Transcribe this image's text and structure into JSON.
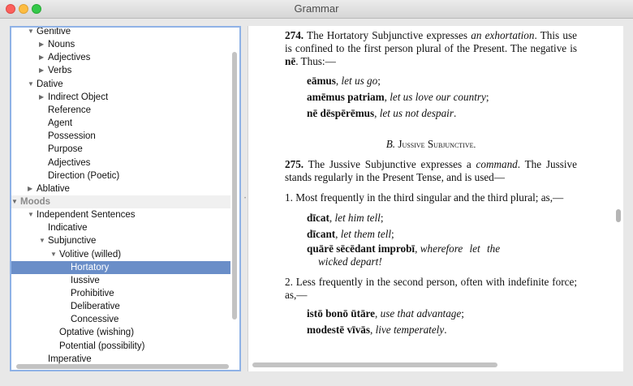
{
  "window": {
    "title": "Grammar"
  },
  "sidebar": {
    "rows": [
      {
        "label": "Genitive",
        "indent": 0,
        "tri": "▼"
      },
      {
        "label": "Nouns",
        "indent": 1,
        "tri": "▶"
      },
      {
        "label": "Adjectives",
        "indent": 1,
        "tri": "▶"
      },
      {
        "label": "Verbs",
        "indent": 1,
        "tri": "▶"
      },
      {
        "label": "Dative",
        "indent": 0,
        "tri": "▼"
      },
      {
        "label": "Indirect Object",
        "indent": 1,
        "tri": "▶"
      },
      {
        "label": "Reference",
        "indent": 1,
        "tri": ""
      },
      {
        "label": "Agent",
        "indent": 1,
        "tri": ""
      },
      {
        "label": "Possession",
        "indent": 1,
        "tri": ""
      },
      {
        "label": "Purpose",
        "indent": 1,
        "tri": ""
      },
      {
        "label": "Adjectives",
        "indent": 1,
        "tri": ""
      },
      {
        "label": "Direction (Poetic)",
        "indent": 1,
        "tri": ""
      },
      {
        "label": "Ablative",
        "indent": 0,
        "tri": "▶"
      },
      {
        "label": "Moods",
        "indent": -1,
        "tri": "▼",
        "group": true
      },
      {
        "label": "Independent Sentences",
        "indent": 0,
        "tri": "▼"
      },
      {
        "label": "Indicative",
        "indent": 1,
        "tri": ""
      },
      {
        "label": "Subjunctive",
        "indent": 1,
        "tri": "▼"
      },
      {
        "label": "Volitive (willed)",
        "indent": 2,
        "tri": "▼"
      },
      {
        "label": "Hortatory",
        "indent": 3,
        "tri": "",
        "selected": true
      },
      {
        "label": "Iussive",
        "indent": 3,
        "tri": ""
      },
      {
        "label": "Prohibitive",
        "indent": 3,
        "tri": ""
      },
      {
        "label": "Deliberative",
        "indent": 3,
        "tri": ""
      },
      {
        "label": "Concessive",
        "indent": 3,
        "tri": ""
      },
      {
        "label": "Optative (wishing)",
        "indent": 2,
        "tri": ""
      },
      {
        "label": "Potential (possibility)",
        "indent": 2,
        "tri": ""
      },
      {
        "label": "Imperative",
        "indent": 1,
        "tri": ""
      }
    ]
  },
  "doc": {
    "s274_num": "274.",
    "s274_a": " The Hortatory Subjunctive expresses ",
    "s274_em": "an exhortation",
    "s274_b": ". This use is confined to the first person plural of the Present. The negative is ",
    "s274_ne": "nē",
    "s274_c": ". Thus:—",
    "ex1": [
      {
        "la": "eāmus",
        "en": "let us go",
        "end": ";"
      },
      {
        "la": "amēmus patriam",
        "en": "let us love our country",
        "end": ";"
      },
      {
        "la": "nē dēspērēmus",
        "en": "let us not despair",
        "end": "."
      }
    ],
    "heading_b": "B.",
    "heading_j": "J",
    "heading_rest": "ussive",
    "heading_s": "S",
    "heading_rest2": "ubjunctive.",
    "s275_num": "275.",
    "s275_a": " The Jussive Subjunctive expresses a ",
    "s275_em": "command",
    "s275_b": ". The Jussive stands regularly in the Present Tense, and is used—",
    "p1": "1. Most frequently in the third singular and the third plural; as,—",
    "ex2": [
      {
        "la": "dīcat",
        "en": "let him tell",
        "end": ";"
      },
      {
        "la": "dīcant",
        "en": "let them tell",
        "end": ";"
      }
    ],
    "ex2c_la": "quārē sēcēdant improbī",
    "ex2c_en1": "wherefore let the",
    "ex2c_en2": "wicked depart!",
    "p2": "2. Less frequently in the second person, often with indefinite force; as,—",
    "ex3": [
      {
        "la": "istō bonō ūtāre",
        "en": "use that advantage",
        "end": ";"
      },
      {
        "la": "modestē vīvās",
        "en": "live temperately",
        "end": "."
      }
    ]
  }
}
